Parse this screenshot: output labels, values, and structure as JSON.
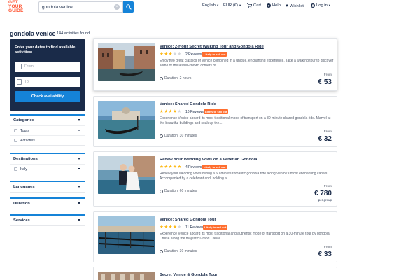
{
  "header": {
    "logo_lines": [
      "GET",
      "YOUR",
      "GUIDE"
    ],
    "search_value": "gondola venice",
    "language": "English",
    "currency": "EUR (€)",
    "cart": "Cart",
    "help": "Help",
    "wishlist": "Wishlist",
    "login": "Log in"
  },
  "results": {
    "title": "gondola venice",
    "count": "144 activities found"
  },
  "date_panel": {
    "prompt": "Enter your dates to find available activities:",
    "from_placeholder": "From",
    "to_placeholder": "To",
    "check_label": "Check availability"
  },
  "filters": {
    "categories": {
      "title": "Categories",
      "options": [
        "Tours",
        "Activities"
      ]
    },
    "destinations": {
      "title": "Destinations",
      "options": [
        "Italy"
      ]
    },
    "languages": {
      "title": "Languages"
    },
    "duration": {
      "title": "Duration"
    },
    "services": {
      "title": "Services"
    }
  },
  "cards": [
    {
      "title": "Venice: 2-Hour Secret Walking Tour and Gondola Ride",
      "rating": 3,
      "reviews": "2 Reviews",
      "badge": "Likely to sell out",
      "desc": "Enjoy two great classics of Venice combined in a unique, enchanting experience. Take a walking tour to discover some of the lesser-known corners of...",
      "duration": "Duration: 2 hours",
      "from": "From",
      "price": "€ 53"
    },
    {
      "title": "Venice: Shared Gondola Ride",
      "rating": 4,
      "reviews": "10 Reviews",
      "badge": "Likely to sell out",
      "desc": "Experience Venice aboard its most traditional mode of transport on a 30-minute shared gondola ride. Marvel at the beautiful buildings and soak up the...",
      "duration": "Duration: 30 minutes",
      "from": "From",
      "price": "€ 32"
    },
    {
      "title": "Renew Your Wedding Vows on a Venetian Gondola",
      "rating": 5,
      "reviews": "4 Reviews",
      "badge": "Likely to sell out",
      "desc": "Renew your wedding vows during a 60-minute romantic gondola ride along Venice's most enchanting canals. Accompanied by a celebrant and, holding a...",
      "duration": "Duration: 60 minutes",
      "from": "From",
      "price": "€ 780",
      "per_group": "per group"
    },
    {
      "title": "Venice: Shared Gondola Tour",
      "rating": 4,
      "reviews": "11 Reviews",
      "badge": "Likely to sell out",
      "desc": "Experience Venice aboard its most traditional and authentic mode of transport on a 30-minute tour by gondola. Cruise along the majestic Grand Canal...",
      "duration": "Duration: 30 minutes",
      "from": "From",
      "price": "€ 33"
    },
    {
      "title": "Secret Venice & Gondola Tour"
    }
  ],
  "colors": {
    "brand": "#ff5533",
    "accent_blue": "#1583d8",
    "navy": "#1a2b49",
    "badge_orange": "#ff6e2f",
    "star": "#fdb813"
  }
}
